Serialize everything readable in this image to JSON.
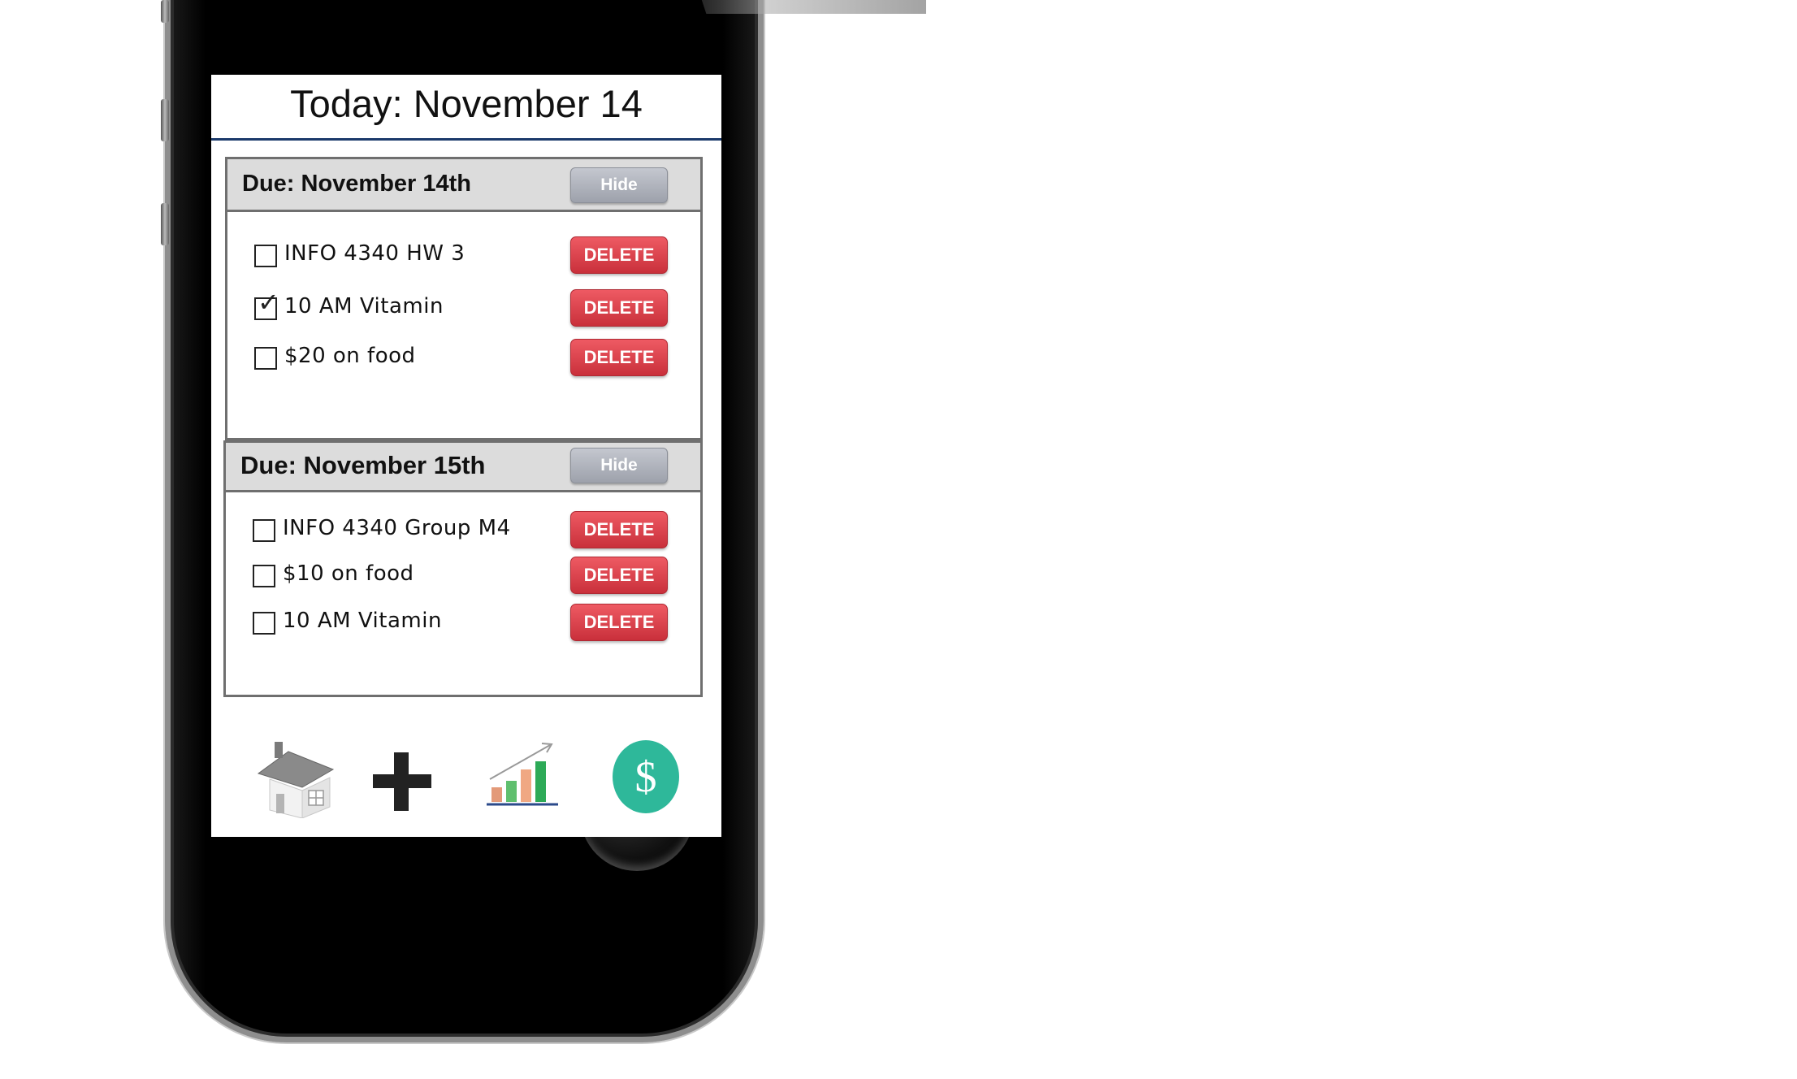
{
  "screen": {
    "title": "Today: November 14"
  },
  "sections": [
    {
      "heading": "Due: November 14th",
      "hide_label": "Hide",
      "items": [
        {
          "label": "INFO 4340 HW 3",
          "checked": false,
          "delete_label": "DELETE"
        },
        {
          "label": "10 AM Vitamin",
          "checked": true,
          "delete_label": "DELETE"
        },
        {
          "label": "$20 on food",
          "checked": false,
          "delete_label": "DELETE"
        }
      ]
    },
    {
      "heading": "Due: November 15th",
      "hide_label": "Hide",
      "items": [
        {
          "label": "INFO 4340 Group M4",
          "checked": false,
          "delete_label": "DELETE"
        },
        {
          "label": "$10 on food",
          "checked": false,
          "delete_label": "DELETE"
        },
        {
          "label": "10 AM Vitamin",
          "checked": false,
          "delete_label": "DELETE"
        }
      ]
    }
  ],
  "tabbar": [
    {
      "icon": "home-icon"
    },
    {
      "icon": "plus-icon"
    },
    {
      "icon": "bar-chart-icon"
    },
    {
      "icon": "dollar-icon",
      "symbol": "$"
    }
  ],
  "colors": {
    "delete": "#d63a45",
    "hide": "#a9adb6",
    "title_rule": "#1b3a6b",
    "money": "#2eb89a"
  }
}
